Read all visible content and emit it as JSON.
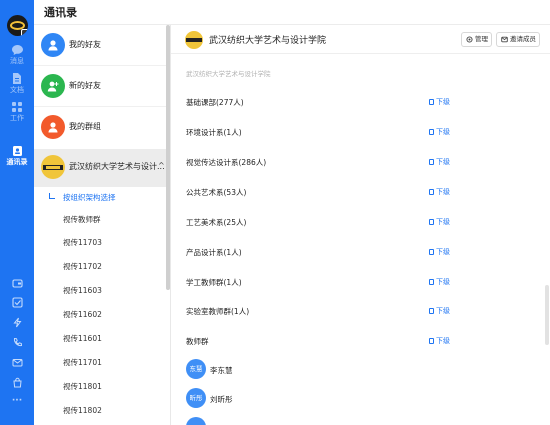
{
  "app": {
    "title": "通讯录"
  },
  "rail": {
    "items": [
      {
        "label": "消息",
        "icon": "chat-icon"
      },
      {
        "label": "文档",
        "icon": "document-icon"
      },
      {
        "label": "工作",
        "icon": "grid-icon"
      },
      {
        "label": "通讯录",
        "icon": "contacts-icon",
        "active": true
      }
    ],
    "bottom_icons": [
      "wallet-icon",
      "checklist-icon",
      "lightning-icon",
      "phone-icon",
      "mail-icon",
      "bag-icon",
      "more-icon"
    ],
    "more_glyph": "···"
  },
  "contacts_nav": {
    "friends": "我的好友",
    "new_friends": "新的好友",
    "groups": "我的群组",
    "org_name": "武汉纺织大学艺术与设计...",
    "org_caret": "^",
    "org_tree": [
      "按组织架构选择",
      "视传教师群",
      "视传11703",
      "视传11702",
      "视传11603",
      "视传11602",
      "视传11601",
      "视传11701",
      "视传11801",
      "视传11802"
    ]
  },
  "org_detail": {
    "title": "武汉纺织大学艺术与设计学院",
    "manage_label": "管理",
    "invite_label": "邀请成员",
    "breadcrumb": "武汉纺织大学艺术与设计学院",
    "sub_label": "下级",
    "departments": [
      "基础课部(277人)",
      "环境设计系(1人)",
      "视觉传达设计系(286人)",
      "公共艺术系(53人)",
      "工艺美术系(25人)",
      "产品设计系(1人)",
      "学工教师群(1人)",
      "实验室教师群(1人)"
    ],
    "teacher_group_label": "教师群",
    "members": [
      {
        "avatar_text": "东慧",
        "name": "李东慧"
      },
      {
        "avatar_text": "昕彤",
        "name": "刘昕彤"
      }
    ]
  },
  "colors": {
    "brand": "#1e74f2",
    "friends_icon": "#2f86f5",
    "new_friends_icon": "#2bb64f",
    "groups_icon": "#f25a2c",
    "org_logo": "#f0c53a"
  }
}
